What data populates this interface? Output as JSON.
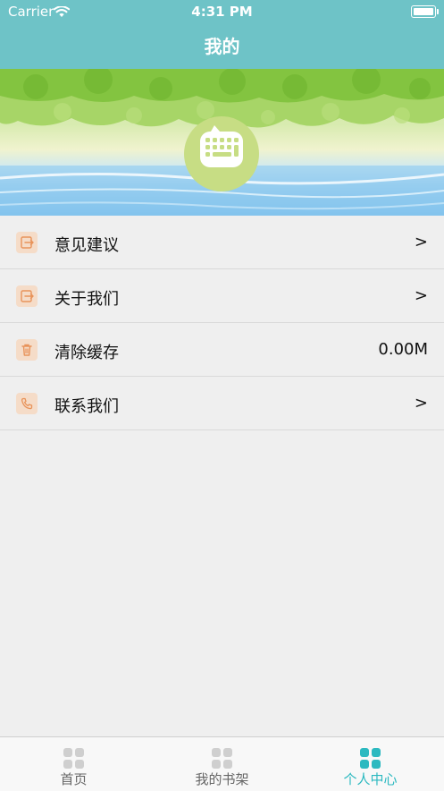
{
  "status_bar": {
    "carrier": "Carrier",
    "time": "4:31 PM"
  },
  "nav": {
    "title": "我的"
  },
  "menu": [
    {
      "label": "意见建议",
      "value": ">",
      "icon": "exit-icon"
    },
    {
      "label": "关于我们",
      "value": ">",
      "icon": "exit-icon"
    },
    {
      "label": "清除缓存",
      "value": "0.00M",
      "icon": "trash-icon"
    },
    {
      "label": "联系我们",
      "value": ">",
      "icon": "phone-icon"
    }
  ],
  "tabs": [
    {
      "label": "首页",
      "active": false
    },
    {
      "label": "我的书架",
      "active": false
    },
    {
      "label": "个人中心",
      "active": true
    }
  ],
  "colors": {
    "nav_bg": "#6ec3c7",
    "accent": "#2cb9c0",
    "icon_orange": "#e8935a",
    "icon_bg": "#f5dcc8"
  }
}
